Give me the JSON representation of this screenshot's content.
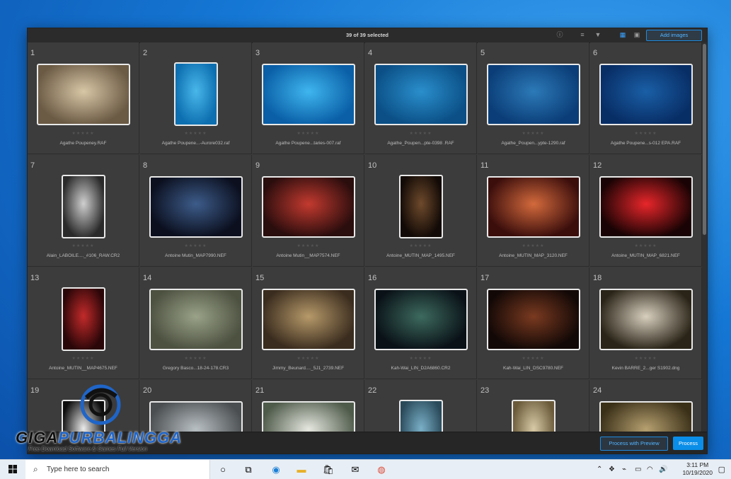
{
  "toolbar": {
    "selection_text": "39 of 39 selected",
    "add_images_label": "Add images"
  },
  "grid": {
    "items": [
      {
        "num": "1",
        "name": "Agathe Poupeney.RAF",
        "orient": "landscape",
        "c1": "#6b5a44",
        "c2": "#d8c7a6"
      },
      {
        "num": "2",
        "name": "Agathe Poupene...-Aurore032.raf",
        "orient": "portrait",
        "c1": "#0d6fb0",
        "c2": "#49b7ea"
      },
      {
        "num": "3",
        "name": "Agathe Poupene...taries-007.raf",
        "orient": "landscape",
        "c1": "#0a5fa6",
        "c2": "#3fb6ef"
      },
      {
        "num": "4",
        "name": "Agathe_Poupen...pte-0398 .RAF",
        "orient": "landscape",
        "c1": "#0b4f86",
        "c2": "#2a8fcc"
      },
      {
        "num": "5",
        "name": "Agathe_Poupen...ypte-1290.raf",
        "orient": "landscape",
        "c1": "#0b3e78",
        "c2": "#2c7ab8"
      },
      {
        "num": "6",
        "name": "Agathe Poupene...s-012 EPA.RAF",
        "orient": "landscape",
        "c1": "#082e66",
        "c2": "#1a5fa6"
      },
      {
        "num": "7",
        "name": "Alain_LABOILE...._#106_RAW.CR2",
        "orient": "portrait",
        "c1": "#2a2a2a",
        "c2": "#cfcfcf"
      },
      {
        "num": "8",
        "name": "Antoine Mutin_MAP7990.NEF",
        "orient": "landscape",
        "c1": "#0b0f1e",
        "c2": "#3d5c8a"
      },
      {
        "num": "9",
        "name": "Antoine Mutin__MAP7574.NEF",
        "orient": "landscape",
        "c1": "#2a0d0d",
        "c2": "#c33a2f"
      },
      {
        "num": "10",
        "name": "Antoine_MUTIN_MAP_1495.NEF",
        "orient": "portrait",
        "c1": "#120a06",
        "c2": "#6e4a2c"
      },
      {
        "num": "11",
        "name": "Antoine_MUTIN_MAP_3120.NEF",
        "orient": "landscape",
        "c1": "#3b0e0c",
        "c2": "#d36a3c"
      },
      {
        "num": "12",
        "name": "Antoine_MUTIN_MAP_6821.NEF",
        "orient": "landscape",
        "c1": "#1a0304",
        "c2": "#e8262a"
      },
      {
        "num": "13",
        "name": "Antoine_MUTIN__MAP4675.NEF",
        "orient": "portrait",
        "c1": "#2a0608",
        "c2": "#c22a2a"
      },
      {
        "num": "14",
        "name": "Gregory Basco...18-24-178.CR3",
        "orient": "landscape",
        "c1": "#4c5140",
        "c2": "#9aa288"
      },
      {
        "num": "15",
        "name": "Jimmy_Beunard...._5J1_2739.NEF",
        "orient": "landscape",
        "c1": "#3a2c1e",
        "c2": "#b79a6a"
      },
      {
        "num": "16",
        "name": "Kah-Wai_LIN_D2A6860.CR2",
        "orient": "landscape",
        "c1": "#0a1218",
        "c2": "#3d6a5e"
      },
      {
        "num": "17",
        "name": "Kah-Wai_LIN_DSC9780.NEF",
        "orient": "landscape",
        "c1": "#120806",
        "c2": "#7a3a20"
      },
      {
        "num": "18",
        "name": "Kevin BARRE_2...ger S1902.dng",
        "orient": "landscape",
        "c1": "#2a2418",
        "c2": "#d8cfbe"
      },
      {
        "num": "19",
        "name": "",
        "orient": "portrait",
        "c1": "#0d0d0d",
        "c2": "#eaeaea"
      },
      {
        "num": "20",
        "name": "",
        "orient": "landscape",
        "c1": "#4a4e50",
        "c2": "#b9c0c4"
      },
      {
        "num": "21",
        "name": "",
        "orient": "landscape",
        "c1": "#4e5a4a",
        "c2": "#e6e8e0"
      },
      {
        "num": "22",
        "name": "",
        "orient": "portrait",
        "c1": "#2a4a5a",
        "c2": "#7ab0c8"
      },
      {
        "num": "23",
        "name": "",
        "orient": "portrait",
        "c1": "#6a5a3a",
        "c2": "#d8caa6"
      },
      {
        "num": "24",
        "name": "",
        "orient": "landscape",
        "c1": "#3a3018",
        "c2": "#b6a070"
      }
    ]
  },
  "footer": {
    "process_preview_label": "Process with Preview",
    "process_label": "Process"
  },
  "watermark": {
    "brand_dark": "GIGA",
    "brand_blue": "PURBALINGGA",
    "tagline": "Free Download Software & Games Full Version"
  },
  "taskbar": {
    "search_placeholder": "Type here to search",
    "time": "3:11 PM",
    "date": "10/19/2020",
    "apps": [
      "cortana-icon",
      "task-view-icon",
      "edge-icon",
      "file-explorer-icon",
      "store-icon",
      "mail-icon",
      "chrome-icon"
    ]
  }
}
